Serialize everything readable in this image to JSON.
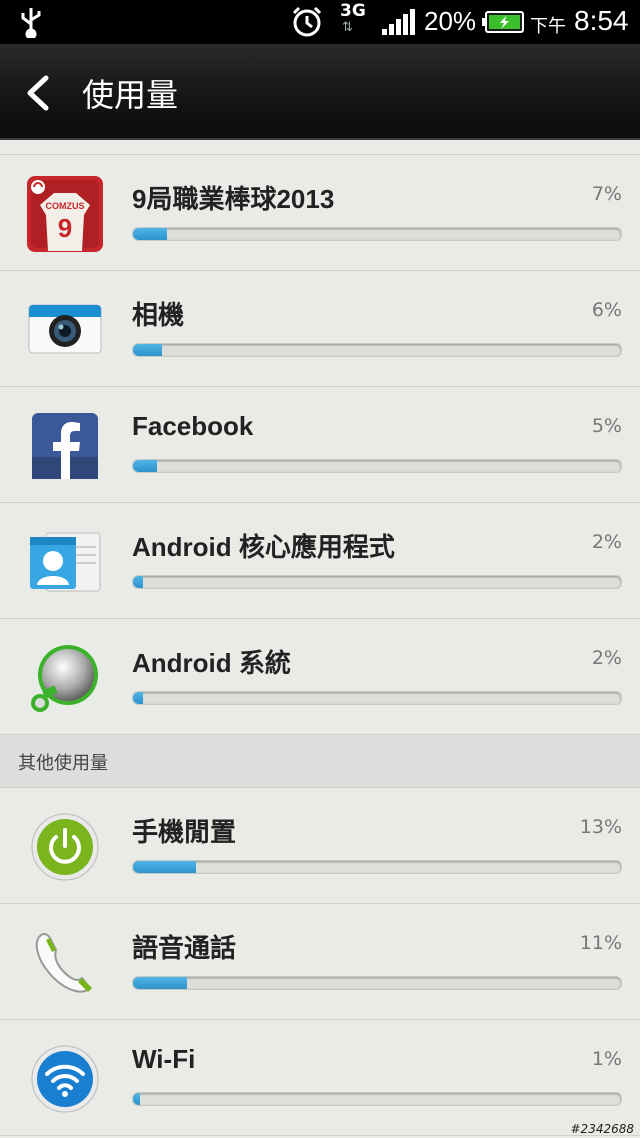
{
  "status_bar": {
    "network": "3G",
    "battery_percent": "20%",
    "ampm": "下午",
    "time": "8:54",
    "icons": [
      "usb-icon",
      "alarm-icon",
      "signal-icon",
      "battery-charging-icon"
    ]
  },
  "action_bar": {
    "title": "使用量",
    "back_icon": "back-chevron-icon"
  },
  "apps": [
    {
      "name": "9局職業棒球2013",
      "percent": "7%",
      "fraction": 0.07,
      "icon": "baseball-game-icon"
    },
    {
      "name": "相機",
      "percent": "6%",
      "fraction": 0.06,
      "icon": "camera-icon"
    },
    {
      "name": "Facebook",
      "percent": "5%",
      "fraction": 0.05,
      "icon": "facebook-icon"
    },
    {
      "name": "Android 核心應用程式",
      "percent": "2%",
      "fraction": 0.02,
      "icon": "contacts-icon"
    },
    {
      "name": "Android 系統",
      "percent": "2%",
      "fraction": 0.02,
      "icon": "android-system-icon"
    }
  ],
  "other_section": {
    "header": "其他使用量",
    "items": [
      {
        "name": "手機閒置",
        "percent": "13%",
        "fraction": 0.13,
        "icon": "power-icon"
      },
      {
        "name": "語音通話",
        "percent": "11%",
        "fraction": 0.11,
        "icon": "phone-icon"
      },
      {
        "name": "Wi-Fi",
        "percent": "1%",
        "fraction": 0.01,
        "icon": "wifi-icon"
      }
    ]
  },
  "colors": {
    "bar_fill": "#2b93cc",
    "background": "#e9ebe7",
    "action_bar": "#141414"
  },
  "watermark": "#2342688"
}
